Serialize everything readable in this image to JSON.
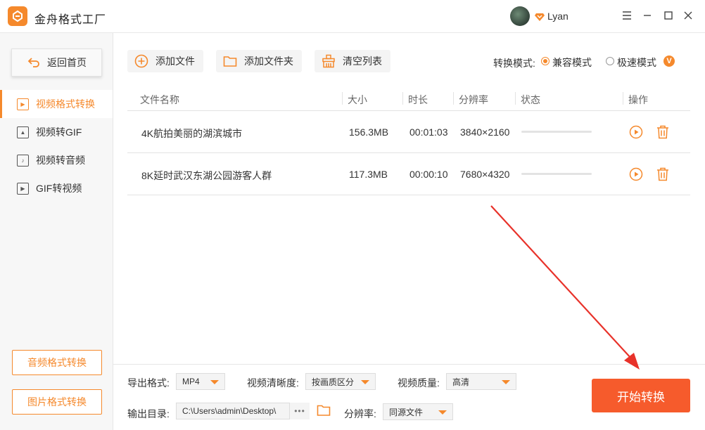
{
  "app": {
    "title": "金舟格式工厂"
  },
  "user": {
    "name": "Lyan"
  },
  "sidebar": {
    "home_label": "返回首页",
    "items": [
      {
        "label": "视频格式转换",
        "icon": "play-file-icon",
        "active": true
      },
      {
        "label": "视频转GIF",
        "icon": "image-file-icon",
        "active": false
      },
      {
        "label": "视频转音频",
        "icon": "music-file-icon",
        "active": false
      },
      {
        "label": "GIF转视频",
        "icon": "play-file-icon",
        "active": false
      }
    ],
    "bottom_buttons": [
      "音频格式转换",
      "图片格式转换"
    ]
  },
  "toolbar": {
    "add_file": "添加文件",
    "add_folder": "添加文件夹",
    "clear_list": "清空列表",
    "mode_label": "转换模式:",
    "mode_compatible": "兼容模式",
    "mode_fast": "极速模式",
    "vip_badge": "V"
  },
  "table": {
    "headers": [
      "文件名称",
      "大小",
      "时长",
      "分辨率",
      "状态",
      "操作"
    ],
    "rows": [
      {
        "name": "4K航拍美丽的湖滨城市",
        "size": "156.3MB",
        "duration": "00:01:03",
        "resolution": "3840×2160",
        "progress": 0
      },
      {
        "name": "8K延时武汉东湖公园游客人群",
        "size": "117.3MB",
        "duration": "00:00:10",
        "resolution": "7680×4320",
        "progress": 0
      }
    ]
  },
  "output": {
    "format_label": "导出格式:",
    "format_value": "MP4",
    "clarity_label": "视频清晰度:",
    "clarity_value": "按画质区分",
    "quality_label": "视频质量:",
    "quality_value": "高清",
    "dir_label": "输出目录:",
    "dir_value": "C:\\Users\\admin\\Desktop\\",
    "dir_more": "•••",
    "resolution_label": "分辨率:",
    "resolution_value": "同源文件",
    "start_button": "开始转换"
  },
  "colors": {
    "accent": "#f5892c",
    "start": "#f65b2c",
    "arrow": "#e8322a"
  }
}
